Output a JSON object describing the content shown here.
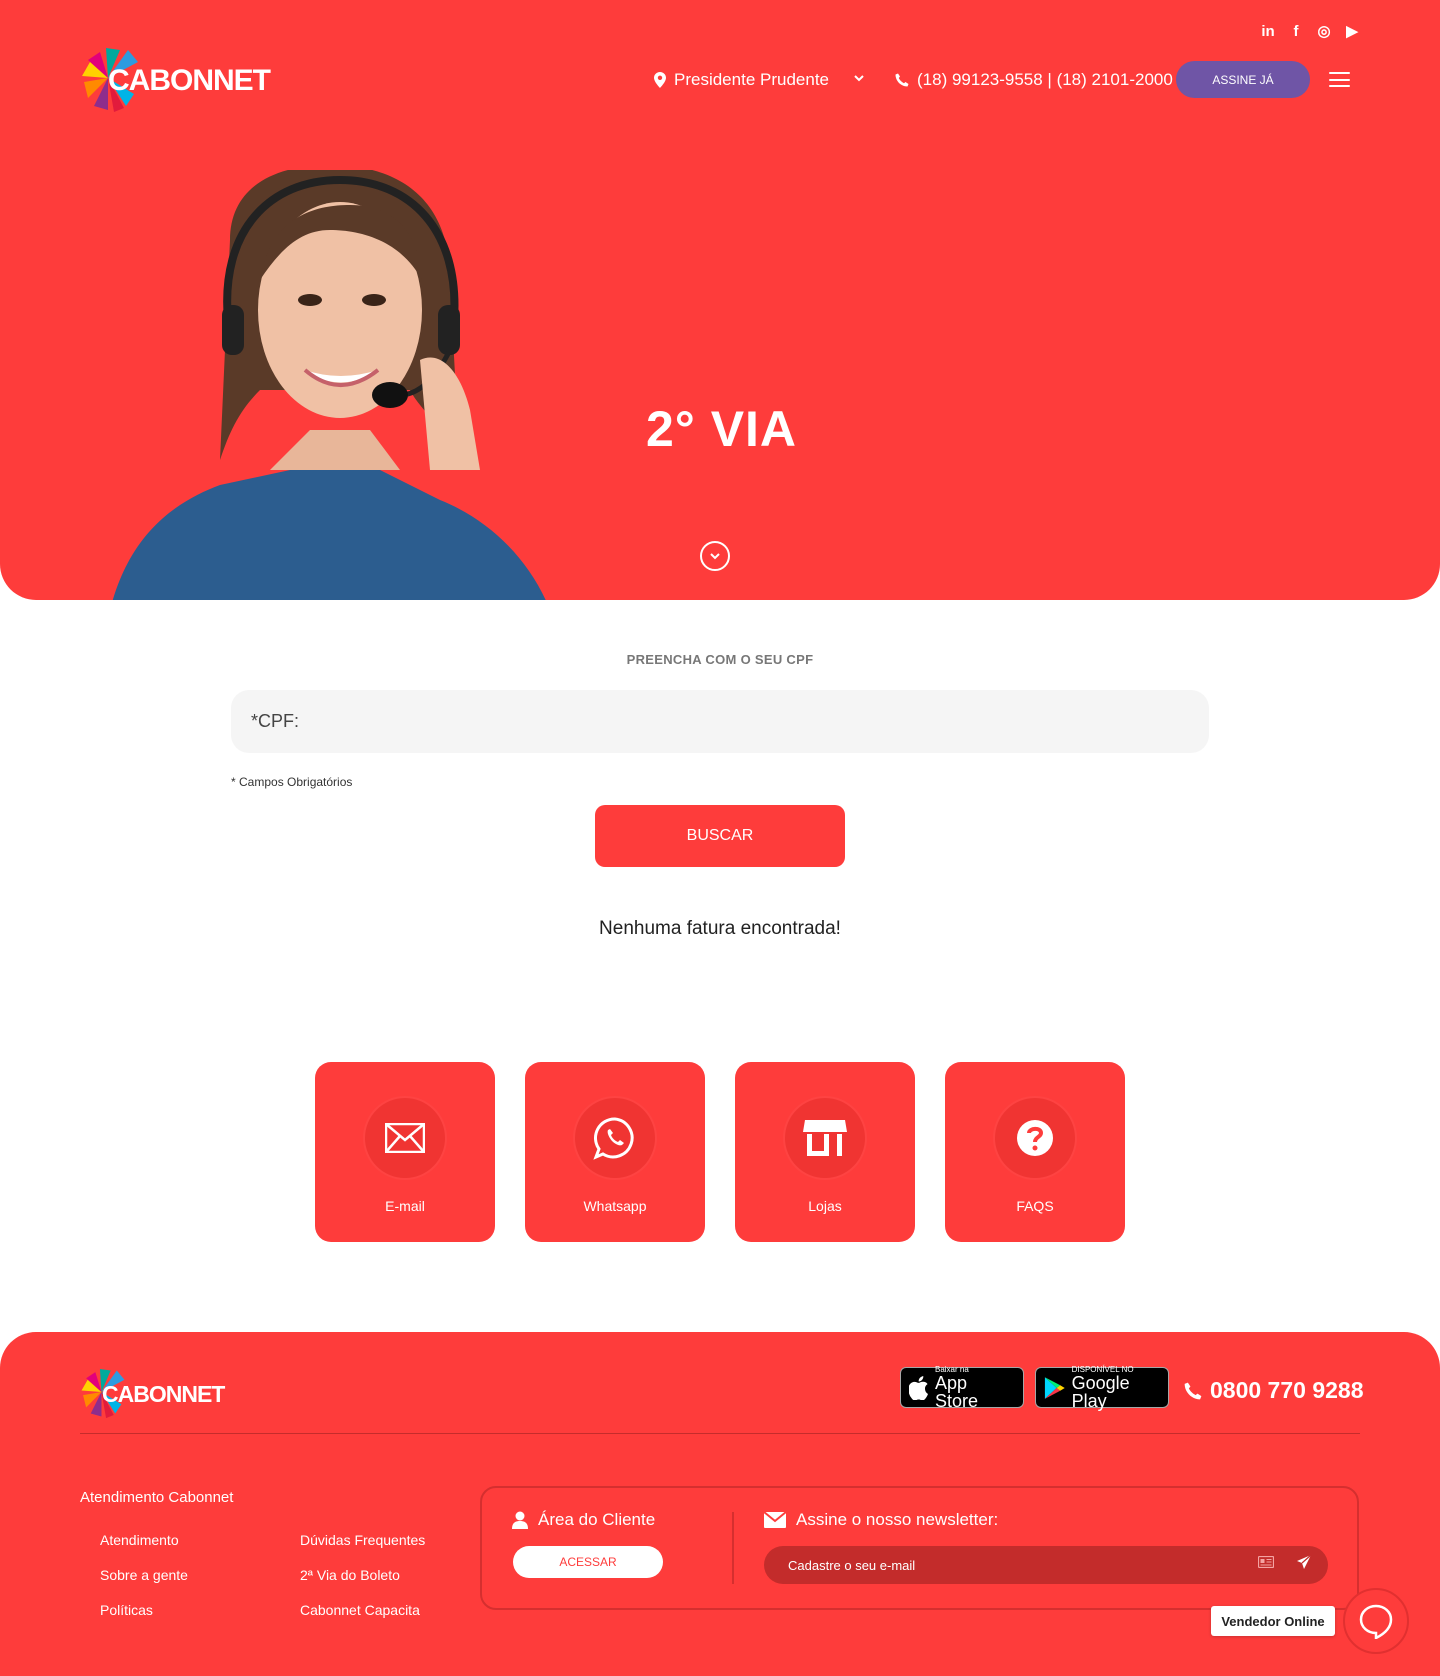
{
  "header": {
    "brand": "CABONNET",
    "social": [
      "in",
      "f",
      "◎",
      "▶"
    ],
    "city": "Presidente Prudente",
    "phone": "(18) 99123-9558 | (18) 2101-2000",
    "cta_label": "ASSINE JÁ",
    "hero_title": "2° VIA"
  },
  "form": {
    "section_label": "PREENCHA COM O SEU CPF",
    "cpf_placeholder": "*CPF:",
    "required_note": "* Campos Obrigatórios",
    "submit_label": "BUSCAR",
    "result_message": "Nenhuma fatura encontrada!"
  },
  "cards": [
    {
      "label": "E-mail",
      "icon": "envelope-icon"
    },
    {
      "label": "Whatsapp",
      "icon": "whatsapp-icon"
    },
    {
      "label": "Lojas",
      "icon": "store-icon"
    },
    {
      "label": "FAQS",
      "icon": "question-icon"
    }
  ],
  "footer": {
    "brand": "CABONNET",
    "appstore_small": "Baixar na",
    "appstore_big": "App Store",
    "googleplay_small": "DISPONÍVEL NO",
    "googleplay_big": "Google Play",
    "phone": "0800 770 9288",
    "section_title": "Atendimento Cabonnet",
    "links_col1": [
      "Atendimento",
      "Sobre a gente",
      "Políticas"
    ],
    "links_col2": [
      "Dúvidas Frequentes",
      "2ª Via do Boleto",
      "Cabonnet Capacita"
    ],
    "client_area_title": "Área do Cliente",
    "client_area_button": "ACESSAR",
    "newsletter_title": "Assine o nosso newsletter:",
    "newsletter_placeholder": "Cadastre o seu e-mail"
  },
  "chat": {
    "vendedor_label": "Vendedor Online"
  },
  "colors": {
    "brand_red": "#fe3c3b",
    "cta_purple": "#6f55a6"
  }
}
